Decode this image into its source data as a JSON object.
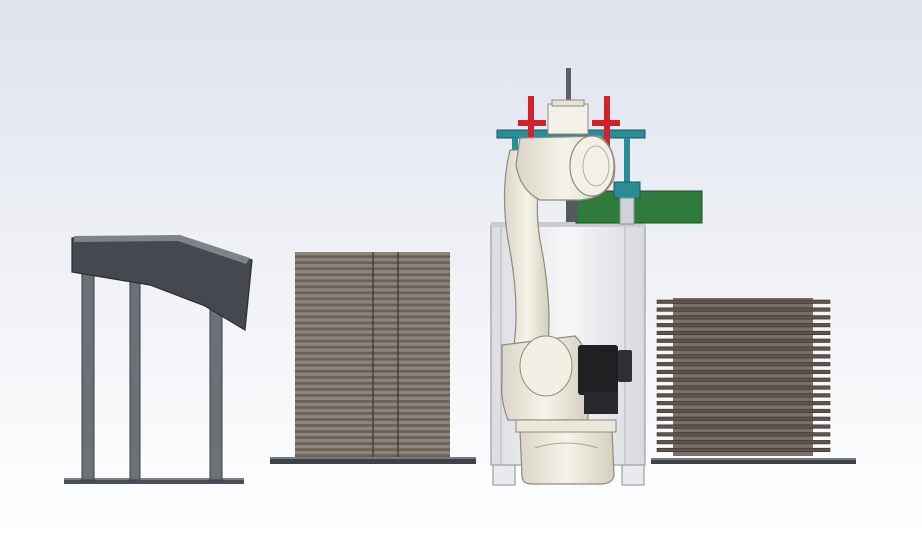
{
  "scene": {
    "kind": "cad-assembly-view",
    "objects": [
      {
        "id": "conveyor-stand",
        "icon": "inclined-table-icon"
      },
      {
        "id": "plate-stack-left",
        "icon": "stacked-plates-icon",
        "layers": 34
      },
      {
        "id": "robot-arm",
        "icon": "industrial-robot-icon"
      },
      {
        "id": "robot-pedestal",
        "icon": "pedestal-icon"
      },
      {
        "id": "gripper",
        "icon": "gripper-icon"
      },
      {
        "id": "tool-rack",
        "icon": "tool-rack-icon"
      },
      {
        "id": "plate-stack-right",
        "icon": "stacked-plates-icon",
        "layers": 20
      }
    ]
  },
  "colors": {
    "background_top": "#dfe3ee",
    "background_bottom": "#ffffff",
    "steel_dark": "#4a4e56",
    "steel_mid": "#7a7f88",
    "plate_brown": "#5e544c",
    "plate_light": "#8e847b",
    "robot_cream": "#f2efe4",
    "robot_shadow": "#cfcbbd",
    "pedestal": "#f1f1f3",
    "motor_black": "#1f2022",
    "gripper_red": "#d3202a",
    "tool_teal": "#2a8c95",
    "tool_green": "#2f7b3c"
  }
}
